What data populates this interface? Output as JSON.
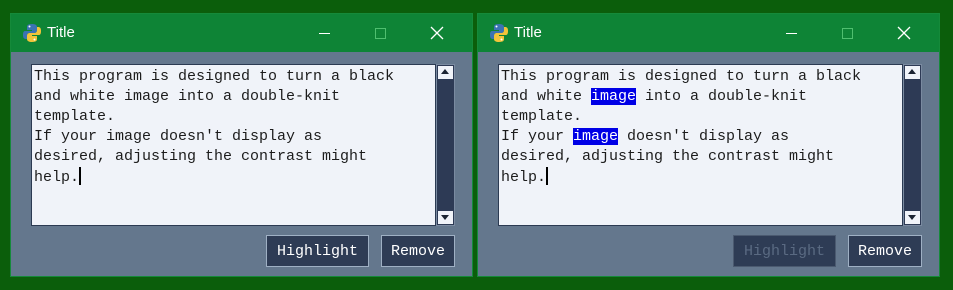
{
  "windows": [
    {
      "title": "Title",
      "lines": [
        [
          {
            "t": "This program is designed to turn a black"
          }
        ],
        [
          {
            "t": "and white image into a double-knit"
          }
        ],
        [
          {
            "t": "template."
          }
        ],
        [
          {
            "t": "If your image doesn't display as"
          }
        ],
        [
          {
            "t": "desired, adjusting the contrast might"
          }
        ],
        [
          {
            "t": "help."
          }
        ]
      ],
      "buttons": {
        "highlight": "Highlight",
        "remove": "Remove"
      },
      "highlight_enabled": true
    },
    {
      "title": "Title",
      "lines": [
        [
          {
            "t": "This program is designed to turn a black"
          }
        ],
        [
          {
            "t": "and white "
          },
          {
            "t": "image",
            "hl": true
          },
          {
            "t": " into a double-knit"
          }
        ],
        [
          {
            "t": "template."
          }
        ],
        [
          {
            "t": "If your "
          },
          {
            "t": "image",
            "hl": true
          },
          {
            "t": " doesn't display as"
          }
        ],
        [
          {
            "t": "desired, adjusting the contrast might"
          }
        ],
        [
          {
            "t": "help."
          }
        ]
      ],
      "buttons": {
        "highlight": "Highlight",
        "remove": "Remove"
      },
      "highlight_enabled": false
    }
  ],
  "colors": {
    "desktop": "#0b5e0b",
    "titlebar": "#0e8436",
    "window_bg": "#64778d",
    "highlight_bg": "#0000e6"
  },
  "icons": {
    "app": "python-icon",
    "minimize": "minimize-icon",
    "maximize": "maximize-icon",
    "close": "close-icon"
  }
}
